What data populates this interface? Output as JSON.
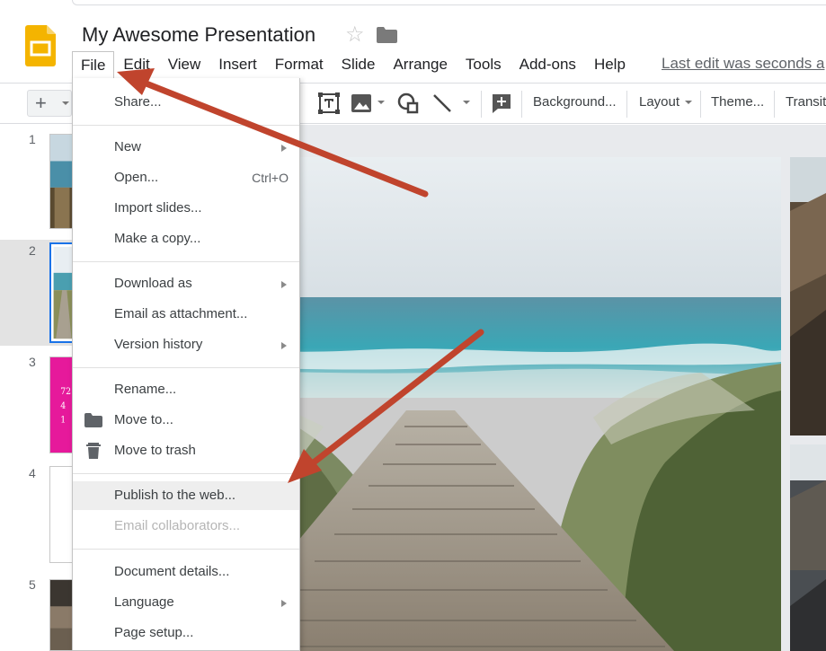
{
  "app": {
    "document_title": "My Awesome Presentation",
    "last_edit": "Last edit was seconds a"
  },
  "menubar": {
    "items": [
      "File",
      "Edit",
      "View",
      "Insert",
      "Format",
      "Slide",
      "Arrange",
      "Tools",
      "Add-ons",
      "Help"
    ]
  },
  "toolbar": {
    "add_symbol": "+",
    "background": "Background...",
    "layout": "Layout",
    "theme": "Theme...",
    "transition": "Transit"
  },
  "filmstrip": {
    "slide_numbers": [
      "1",
      "2",
      "3",
      "4",
      "5"
    ],
    "slide3_text": [
      "72",
      "4",
      "1"
    ]
  },
  "file_menu": {
    "share": "Share...",
    "new": "New",
    "open": "Open...",
    "open_shortcut": "Ctrl+O",
    "import_slides": "Import slides...",
    "make_copy": "Make a copy...",
    "download_as": "Download as",
    "email_attachment": "Email as attachment...",
    "version_history": "Version history",
    "rename": "Rename...",
    "move_to": "Move to...",
    "move_to_trash": "Move to trash",
    "publish": "Publish to the web...",
    "email_collaborators": "Email collaborators...",
    "document_details": "Document details...",
    "language": "Language",
    "page_setup": "Page setup..."
  },
  "colors": {
    "accent_blue": "#1a73e8",
    "slides_yellow": "#f4b400",
    "annotation_arrow": "#c0442d",
    "slide3_pink": "#e6199b"
  }
}
